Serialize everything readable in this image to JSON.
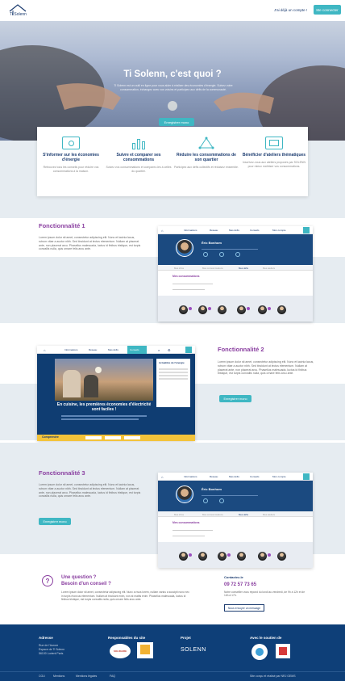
{
  "header": {
    "logo_text": "Ti Solenn",
    "login_link": "J'ai déjà un compte !",
    "signup_button": "Me connecter"
  },
  "hero": {
    "title": "Ti Solenn, c'est quoi ?",
    "text": "Ti Solenn est un outil en ligne pour vous aider à réaliser des économies d'énergie. Suivez votre consommation, échangez avec vos voisins et participez aux défis de la communauté.",
    "button": "Enregistrer mono"
  },
  "features": [
    {
      "icon": "target-icon",
      "title": "S'informer sur les économies d'énergie",
      "text": "Retrouvez tous les conseils pour réduire vos consommations à la maison."
    },
    {
      "icon": "chart-icon",
      "title": "Suivre et comparer ses consommations",
      "text": "Suivez vos consommations et comparez-les à celles du quartier."
    },
    {
      "icon": "network-icon",
      "title": "Réduire les consommations de son quartier",
      "text": "Participez aux défis collectifs et réduisez ensemble."
    },
    {
      "icon": "screen-icon",
      "title": "Bénéficier d'ateliers thématiques",
      "text": "Inscrivez-vous aux ateliers proposés par SOLENN pour mieux maîtriser vos consommations."
    }
  ],
  "section1": {
    "title": "Fonctionnalité 1",
    "text": "Lorem ipsum dolor sit amet, consectetur adipiscing elit. Nunc et lacinia lacus, rutrum vitae a auctor nibh. Sed tincidunt at lectus elementum. Nullam at placerat ante, non placerat arcu. Phasellus malesuada, luctus id finibus tristique, est turpis convallis nulla, quis ornare felis arcu ante.",
    "button": "Enregistrer mono",
    "mock_nav": [
      "Informations",
      "Réseau",
      "Mes défis",
      "Conseils",
      "Mon compte"
    ],
    "profile_name": "Éric Bonhom",
    "tabs": [
      "Mes infos",
      "Mes consommations",
      "Mes défis",
      "Mes ateliers"
    ],
    "form_title": "Mes consommations"
  },
  "section2": {
    "title": "Fonctionnalité 2",
    "text": "Lorem ipsum dolor sit amet, consectetur adipiscing elit. Nunc et lacinia lacus, rutrum vitae a auctor nibh. Sed tincidunt at lectus elementum. Nullam at placerat ante, non placerat arcu. Phasellus malesuada, luctus id finibus tristique, est turpis convallis nulla, quis ornare felis arcu ante.",
    "button": "Enregistrer mono",
    "mock_nav": [
      "Informations",
      "Réseau",
      "Mes défis",
      "Conseils"
    ],
    "banner_text": "En cuisine, les premières économies d'électricité sont faciles !",
    "sidebar_title": "Actualités de l'énergie",
    "footer_label": "Comprendre"
  },
  "section3": {
    "title": "Fonctionnalité 3",
    "text": "Lorem ipsum dolor sit amet, consectetur adipiscing elit. Nunc et lacinia lacus, rutrum vitae a auctor nibh. Sed tincidunt at lectus elementum. Nullam at placerat ante, non placerat arcu. Phasellus malesuada, luctus id finibus tristique, est turpis convallis nulla, quis ornare felis arcu ante.",
    "button": "Enregistrer mono"
  },
  "question": {
    "title1": "Une question ?",
    "title2": "Besoin d'un conseil ?",
    "text": "Lorem ipsum dolor sit amet, consectetur adipiscing elit. Nunc a risus lorem, nullam varius a suscipit nunc nec in turpis rhoncus elementum. Nullam at tincidunt enim, non at mattis enim. Phasellus malesuada, luctus id finibus tristique, est turpis convallis nulla, quis ornare felis arcu ante.",
    "contact_label": "Contactez-le",
    "phone": "09 72 57 73 65",
    "contact_text": "Notre conseiller vous répond du lundi au vendredi, de 9h à 12h et de 14h à 17h.",
    "contact_button": "Nous envoyer un message"
  },
  "footer": {
    "address_title": "Adresse",
    "address_lines": [
      "Rue de l'Aurore",
      "Espace de Ti Solenn",
      "56100 Lorient Paris"
    ],
    "partners_title": "Responsables du site",
    "project_title": "Projet",
    "project_logo": "SOLENN",
    "support_title": "Avec le soutien de",
    "bottom_links": [
      "CGU",
      "Mentions",
      "Mentions légales",
      "FAQ"
    ],
    "copyright": "Site conçu et réalisé par NRJ GEMS"
  },
  "colors": {
    "teal": "#3fb7c3",
    "purple": "#8a3fa0",
    "navy": "#0e3f78"
  }
}
